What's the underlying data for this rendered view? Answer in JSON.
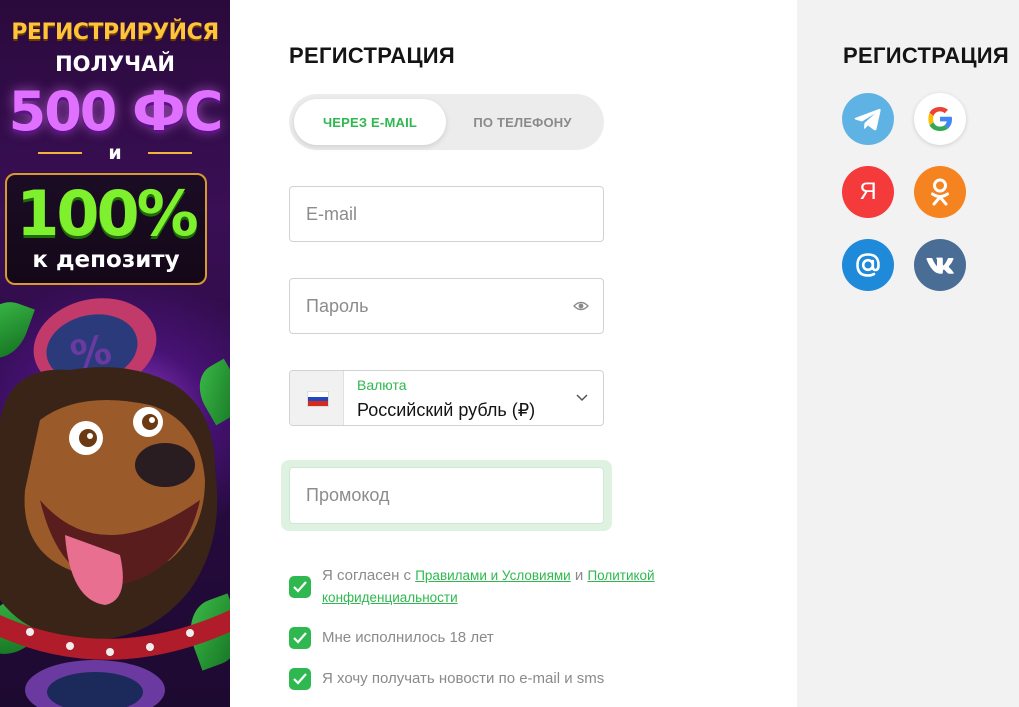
{
  "banner": {
    "headline": "РЕГИСТРИРУЙСЯ",
    "subline": "ПОЛУЧАЙ",
    "free_spins": "500 ФС",
    "conjunction": "и",
    "bonus_percent": "100%",
    "bonus_text": "к депозиту"
  },
  "form": {
    "title": "РЕГИСТРАЦИЯ",
    "tabs": [
      {
        "label": "ЧЕРЕЗ E-MAIL",
        "active": true
      },
      {
        "label": "ПО ТЕЛЕФОНУ",
        "active": false
      }
    ],
    "email_placeholder": "E-mail",
    "password_placeholder": "Пароль",
    "currency": {
      "label": "Валюта",
      "value": "Российский рубль (₽)",
      "flag": "russia-flag"
    },
    "promo_placeholder": "Промокод",
    "agreements": [
      {
        "checked": true,
        "text_before": "Я согласен с ",
        "link1": "Правилами и Условиями",
        "text_middle": " и ",
        "link2_line1": "Политикой",
        "link2_line2": "конфиденциальности"
      },
      {
        "checked": true,
        "text": "Мне исполнилось 18 лет"
      },
      {
        "checked": true,
        "text": "Я хочу получать новости по e-mail и sms"
      }
    ]
  },
  "social": {
    "title": "РЕГИСТРАЦИЯ",
    "providers": [
      {
        "name": "telegram",
        "icon": "telegram-icon",
        "color": "#5fb2e4"
      },
      {
        "name": "google",
        "icon": "google-icon",
        "color": "#ffffff"
      },
      {
        "name": "yandex",
        "icon": "yandex-icon",
        "color": "#f43a3a",
        "glyph": "Я"
      },
      {
        "name": "odnoklassniki",
        "icon": "odnoklassniki-icon",
        "color": "#f5831f"
      },
      {
        "name": "mail.ru",
        "icon": "at-sign-icon",
        "color": "#1f89da"
      },
      {
        "name": "vkontakte",
        "icon": "vk-icon",
        "color": "#4a6d95"
      }
    ]
  },
  "colors": {
    "accent": "#2fb84f",
    "side_panel": "#f2f2f2",
    "switcher_bg": "#ececec"
  }
}
